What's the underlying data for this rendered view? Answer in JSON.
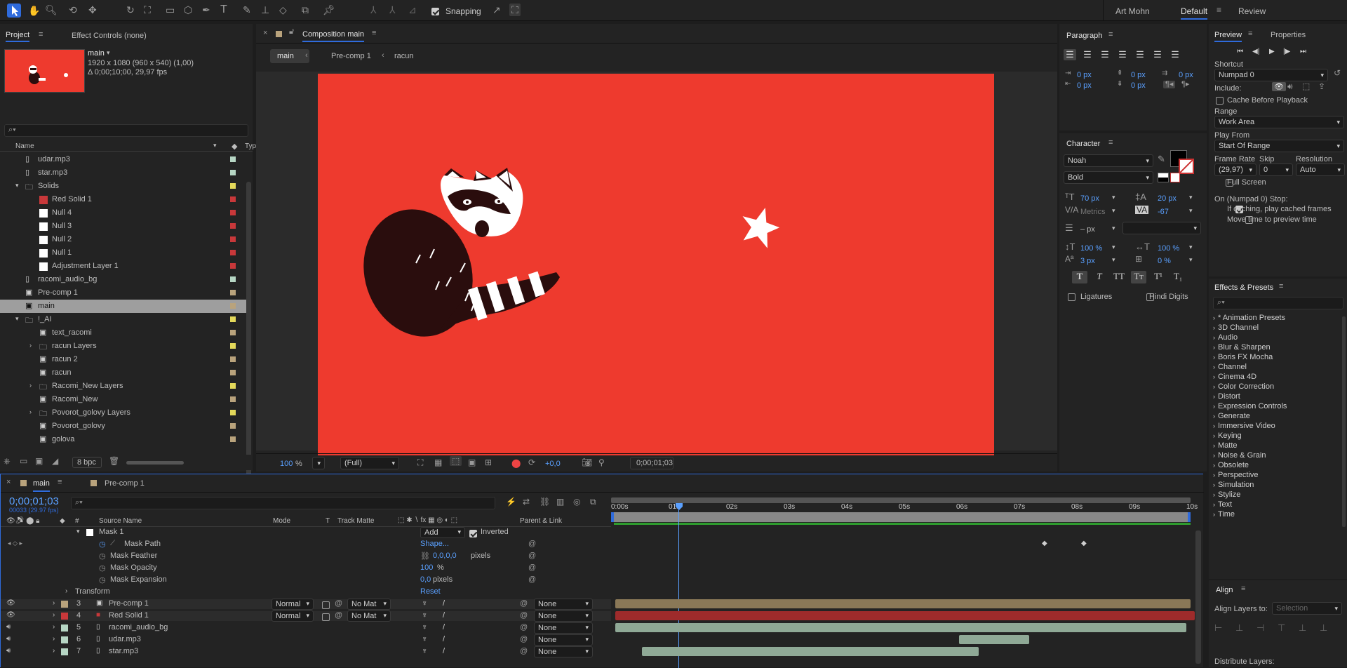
{
  "toolbar": {
    "snapping_label": "Snapping",
    "workspaces": [
      "Art Mohn",
      "Default",
      "Review"
    ]
  },
  "project": {
    "tab": "Project",
    "effect_controls_tab": "Effect Controls (none)",
    "thumb_name": "main",
    "thumb_dims": "1920 x 1080  (960 x 540) (1,00)",
    "thumb_duration": "Δ 0;00;10;00, 29,97 fps",
    "search_placeholder": "",
    "col_name": "Name",
    "col_type": "Typ",
    "bpc": "8 bpc",
    "items": [
      {
        "label": "udar.mp3",
        "icon": "audio-file-icon",
        "color": "#b6d6c4",
        "indent": 1
      },
      {
        "label": "star.mp3",
        "icon": "audio-file-icon",
        "color": "#b6d6c4",
        "indent": 1
      },
      {
        "label": "Solids",
        "icon": "folder-icon",
        "color": "#e3d85a",
        "indent": 1,
        "expanded": true
      },
      {
        "label": "Red Solid 1",
        "icon": "red-solid-icon",
        "color": "#c8383a",
        "indent": 2
      },
      {
        "label": "Null 4",
        "icon": "white-solid-icon",
        "color": "#c8383a",
        "indent": 2
      },
      {
        "label": "Null 3",
        "icon": "white-solid-icon",
        "color": "#c8383a",
        "indent": 2
      },
      {
        "label": "Null 2",
        "icon": "white-solid-icon",
        "color": "#c8383a",
        "indent": 2
      },
      {
        "label": "Null 1",
        "icon": "white-solid-icon",
        "color": "#c8383a",
        "indent": 2
      },
      {
        "label": "Adjustment Layer 1",
        "icon": "white-solid-icon",
        "color": "#c8383a",
        "indent": 2
      },
      {
        "label": "racomi_audio_bg",
        "icon": "audio-file-icon",
        "color": "#b6d6c4",
        "indent": 1
      },
      {
        "label": "Pre-comp 1",
        "icon": "composition-icon",
        "color": "#b9a37c",
        "indent": 1
      },
      {
        "label": "main",
        "icon": "composition-icon",
        "color": "#b9a37c",
        "indent": 1,
        "selected": true
      },
      {
        "label": "!_AI",
        "icon": "folder-icon",
        "color": "#e3d85a",
        "indent": 1,
        "expanded": true
      },
      {
        "label": "text_racomi",
        "icon": "composition-icon",
        "color": "#b9a37c",
        "indent": 2
      },
      {
        "label": "racun Layers",
        "icon": "folder-icon",
        "color": "#e3d85a",
        "indent": 2,
        "collapsed": true
      },
      {
        "label": "racun 2",
        "icon": "composition-icon",
        "color": "#b9a37c",
        "indent": 2
      },
      {
        "label": "racun",
        "icon": "composition-icon",
        "color": "#b9a37c",
        "indent": 2
      },
      {
        "label": "Racomi_New Layers",
        "icon": "folder-icon",
        "color": "#e3d85a",
        "indent": 2,
        "collapsed": true
      },
      {
        "label": "Racomi_New",
        "icon": "composition-icon",
        "color": "#b9a37c",
        "indent": 2
      },
      {
        "label": "Povorot_golovy Layers",
        "icon": "folder-icon",
        "color": "#e3d85a",
        "indent": 2,
        "collapsed": true
      },
      {
        "label": "Povorot_golovy",
        "icon": "composition-icon",
        "color": "#b9a37c",
        "indent": 2
      },
      {
        "label": "golova",
        "icon": "composition-icon",
        "color": "#b9a37c",
        "indent": 2
      }
    ]
  },
  "comp": {
    "tab_title": "Composition main",
    "breadcrumbs": [
      "main",
      "Pre-comp 1",
      "racun"
    ],
    "zoom": "100",
    "zoom_unit": "%",
    "resolution": "(Full)",
    "exposure": "+0,0",
    "timecode": "0;00;01;03",
    "bg_color": "#ee3a2e"
  },
  "paragraph": {
    "title": "Paragraph",
    "indents": [
      "0 px",
      "0 px",
      "0 px",
      "0 px",
      "0 px"
    ]
  },
  "character": {
    "title": "Character",
    "font": "Noah",
    "style": "Bold",
    "size": "70 px",
    "leading": "20 px",
    "kerning": "Metrics",
    "tracking": "-67",
    "stroke": "– px",
    "vscale": "100 %",
    "hscale": "100 %",
    "baseline": "3 px",
    "tsume": "0 %",
    "ligatures": "Ligatures",
    "hindi": "Hindi Digits"
  },
  "preview": {
    "tab": "Preview",
    "properties_tab": "Properties",
    "shortcut_label": "Shortcut",
    "shortcut_value": "Numpad 0",
    "include_label": "Include:",
    "cache_label": "Cache Before Playback",
    "range_label": "Range",
    "range_value": "Work Area",
    "playfrom_label": "Play From",
    "playfrom_value": "Start Of Range",
    "framerate_label": "Frame Rate",
    "skip_label": "Skip",
    "resolution_label": "Resolution",
    "framerate_value": "(29,97)",
    "skip_value": "0",
    "resolution_value": "Auto",
    "fullscreen_label": "Full Screen",
    "stop_label": "On (Numpad 0) Stop:",
    "if_caching_label": "If caching, play cached frames",
    "move_time_label": "Move time to preview time"
  },
  "effects": {
    "title": "Effects & Presets",
    "items": [
      "* Animation Presets",
      "3D Channel",
      "Audio",
      "Blur & Sharpen",
      "Boris FX Mocha",
      "Channel",
      "Cinema 4D",
      "Color Correction",
      "Distort",
      "Expression Controls",
      "Generate",
      "Immersive Video",
      "Keying",
      "Matte",
      "Noise & Grain",
      "Obsolete",
      "Perspective",
      "Simulation",
      "Stylize",
      "Text",
      "Time"
    ]
  },
  "align": {
    "title": "Align",
    "align_to_label": "Align Layers to:",
    "align_to_value": "Selection",
    "distribute_label": "Distribute Layers:"
  },
  "timeline": {
    "tabs": [
      "main",
      "Pre-comp 1"
    ],
    "timecode": "0;00;01;03",
    "frame_info": "00033 (29.97 fps)",
    "col_source": "Source Name",
    "col_mode": "Mode",
    "col_t": "T",
    "col_matte": "Track Matte",
    "col_parent": "Parent & Link",
    "ruler": [
      "0:00s",
      "01s",
      "02s",
      "03s",
      "04s",
      "05s",
      "06s",
      "07s",
      "08s",
      "09s",
      "10s"
    ],
    "mask": {
      "name": "Mask 1",
      "mode": "Add",
      "inverted": "Inverted",
      "path_label": "Mask Path",
      "path_value": "Shape...",
      "feather_label": "Mask Feather",
      "feather_value": "0,0,0,0",
      "feather_unit": "pixels",
      "opacity_label": "Mask Opacity",
      "opacity_value": "100",
      "opacity_unit": "%",
      "expansion_label": "Mask Expansion",
      "expansion_value": "0,0",
      "expansion_unit": "pixels",
      "transform_label": "Transform",
      "reset_label": "Reset"
    },
    "layers": [
      {
        "num": "3",
        "name": "Pre-comp 1",
        "color": "#b9a37c",
        "mode": "Normal",
        "matte": "No Mat",
        "parent": "None",
        "bar_color": "#8a7857"
      },
      {
        "num": "4",
        "name": "Red Solid 1",
        "color": "#c8383a",
        "mode": "Normal",
        "matte": "No Mat",
        "parent": "None",
        "bar_color": "#9e2b2b"
      },
      {
        "num": "5",
        "name": "racomi_audio_bg",
        "color": "#b6d6c4",
        "parent": "None",
        "bar_color": "#8fa996"
      },
      {
        "num": "6",
        "name": "udar.mp3",
        "color": "#b6d6c4",
        "parent": "None",
        "bar_color": "#8fa996"
      },
      {
        "num": "7",
        "name": "star.mp3",
        "color": "#b6d6c4",
        "parent": "None",
        "bar_color": "#8fa996"
      }
    ]
  }
}
